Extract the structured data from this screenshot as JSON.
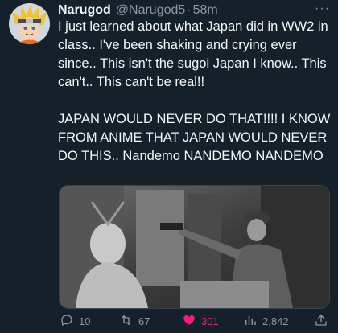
{
  "tweet": {
    "display_name": "Narugod",
    "handle": "@Narugod5",
    "separator": "·",
    "time": "58m",
    "paragraph1": "I just learned about what Japan did in WW2 in class.. I've been shaking and crying ever since.. This isn't the sugoi Japan I know.. This can't.. This can't be real!!",
    "paragraph2": "JAPAN WOULD NEVER DO THAT!!!! I KNOW FROM ANIME THAT JAPAN WOULD NEVER DO THIS.. Nandemo NANDEMO NANDEMO"
  },
  "actions": {
    "replies": "10",
    "retweets": "67",
    "likes": "301",
    "views": "2,842",
    "like_color": "#f91880"
  },
  "more_label": "···",
  "icons": {
    "reply": "reply-icon",
    "retweet": "retweet-icon",
    "like": "heart-icon",
    "views": "views-icon",
    "share": "share-icon",
    "more": "more-icon"
  }
}
